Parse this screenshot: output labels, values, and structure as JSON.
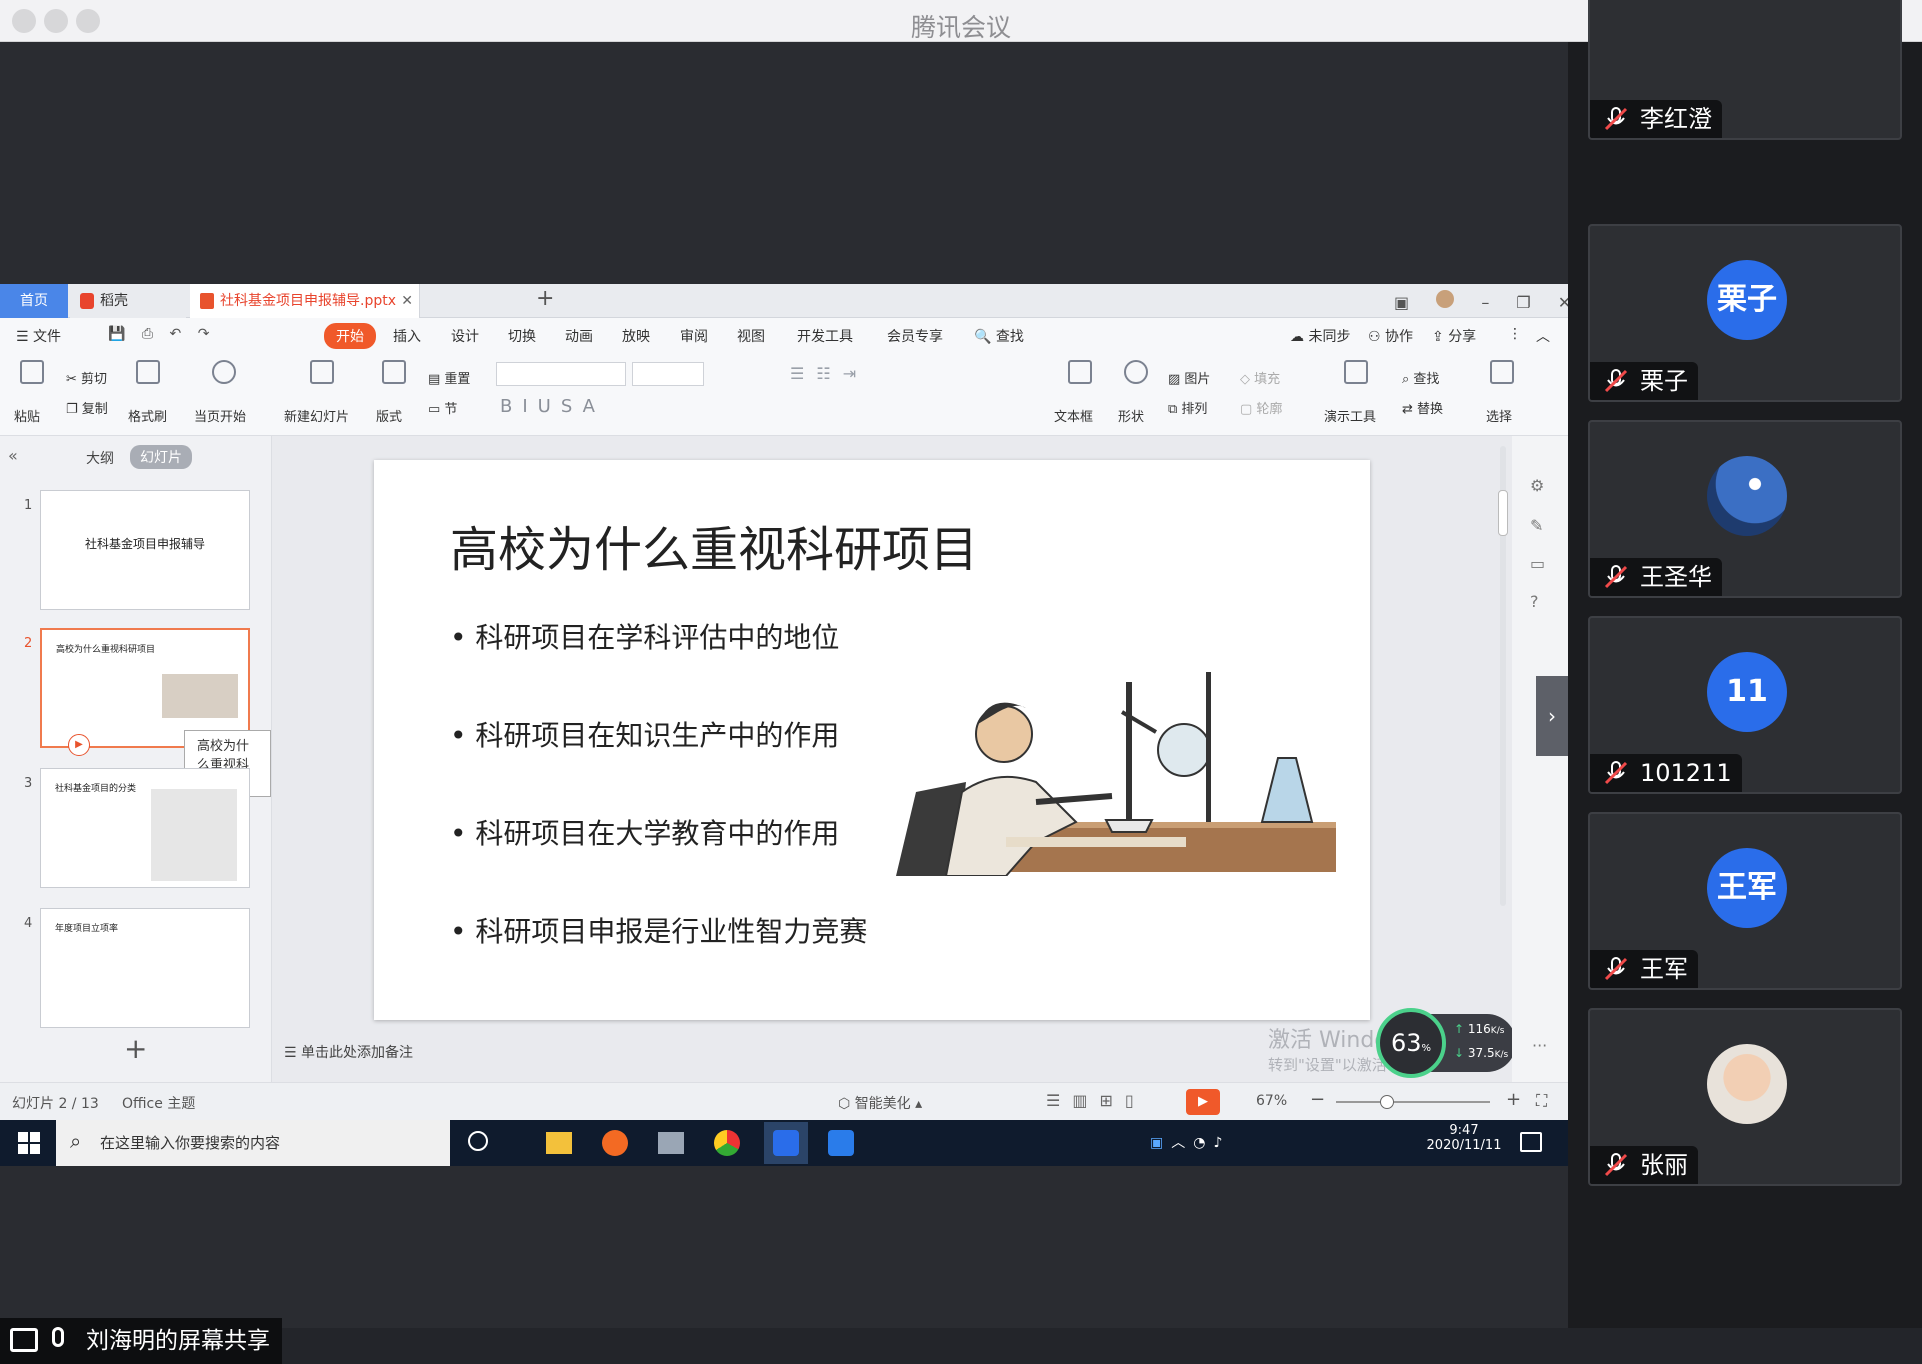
{
  "window": {
    "title": "腾讯会议"
  },
  "share": {
    "label": "刘海明的屏幕共享"
  },
  "participants": [
    {
      "name": "李红澄",
      "initial": ""
    },
    {
      "name": "栗子",
      "initial": "栗子"
    },
    {
      "name": "王圣华",
      "initial": ""
    },
    {
      "name": "101211",
      "initial": "11"
    },
    {
      "name": "王军",
      "initial": "王军"
    },
    {
      "name": "张丽",
      "initial": ""
    }
  ],
  "wps": {
    "tabs": {
      "home": "首页",
      "daoke": "稻壳",
      "file": "社科基金项目申报辅导.pptx"
    },
    "menu": {
      "file": "文件",
      "start": "开始",
      "insert": "插入",
      "design": "设计",
      "transition": "切换",
      "animation": "动画",
      "slideshow": "放映",
      "review": "审阅",
      "view": "视图",
      "devtools": "开发工具",
      "member": "会员专享",
      "search": "查找",
      "unsynced": "未同步",
      "collab": "协作",
      "share": "分享"
    },
    "ribbon": {
      "paste": "粘贴",
      "cut": "剪切",
      "copy": "复制",
      "format_painter": "格式刷",
      "from_current": "当页开始",
      "new_slide": "新建幻灯片",
      "layout": "版式",
      "reset": "重置",
      "section": "节",
      "textbox": "文本框",
      "shape": "形状",
      "picture": "图片",
      "fill": "填充",
      "arrange": "排列",
      "outline": "轮廓",
      "present_tools": "演示工具",
      "find": "查找",
      "replace": "替换",
      "select": "选择"
    },
    "panel": {
      "outline": "大纲",
      "slides": "幻灯片",
      "tooltip": "高校为什么重视科研项目"
    },
    "thumbs": [
      {
        "num": "1",
        "title": "社科基金项目申报辅导"
      },
      {
        "num": "2",
        "title": "高校为什么重视科研项目"
      },
      {
        "num": "3",
        "title": "社科基金项目的分类"
      },
      {
        "num": "4",
        "title": "年度项目立项率"
      }
    ],
    "slide": {
      "title": "高校为什么重视科研项目",
      "bullets": [
        "科研项目在学科评估中的地位",
        "科研项目在知识生产中的作用",
        "科研项目在大学教育中的作用",
        "科研项目申报是行业性智力竞赛"
      ]
    },
    "notes_placeholder": "单击此处添加备注",
    "status": {
      "slide_index": "幻灯片 2 / 13",
      "theme": "Office 主题",
      "beautify": "智能美化",
      "zoom": "67%"
    },
    "watermark": {
      "line1": "激活 Windows",
      "line2": "转到\"设置\"以激活 Windows。"
    },
    "netspeed": {
      "percent": "63",
      "up": "116",
      "down": "37.5",
      "unit": "K/s"
    }
  },
  "taskbar": {
    "search_placeholder": "在这里输入你要搜索的内容",
    "time": "9:47",
    "date": "2020/11/11"
  }
}
